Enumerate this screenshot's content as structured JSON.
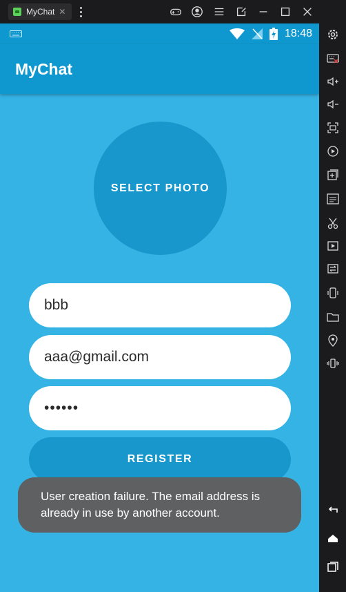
{
  "window": {
    "tab_label": "MyChat",
    "tab_close": "✕"
  },
  "status_bar": {
    "time": "18:48"
  },
  "app_bar": {
    "title": "MyChat"
  },
  "form": {
    "select_photo_label": "SELECT PHOTO",
    "name_value": "bbb",
    "email_value": "aaa@gmail.com",
    "password_value": "••••••",
    "register_label": "REGISTER"
  },
  "toast": {
    "message": "User creation failure. The email address is already in use by another account."
  },
  "colors": {
    "screen_background": "#35b3e5",
    "app_bar": "#0f98cf",
    "button": "#1797cb",
    "toast": "#5e6062"
  }
}
